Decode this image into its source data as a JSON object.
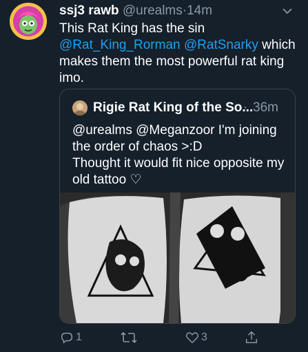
{
  "tweet": {
    "display_name": "ssj3 rawb",
    "handle": "@urealms",
    "dot": "·",
    "time": "14m",
    "text_line1": "This Rat King has the sin",
    "mention1": "@Rat_King_Rorman",
    "mention2": "@RatSnarky",
    "text_after": " which makes them the most powerful rat king imo."
  },
  "quote": {
    "display_name": "Rigie Rat King of the So...",
    "dot": "·",
    "time": "36m",
    "line1": "@urealms @Meganzoor I'm joining the order of chaos >:D",
    "line2": "Thought it would fit nice opposite my old tattoo ♡"
  },
  "actions": {
    "reply_count": "1",
    "retweet_count": "",
    "like_count": "3"
  },
  "icons": {
    "chevron": "chevron-down-icon",
    "reply": "reply-icon",
    "retweet": "retweet-icon",
    "like": "heart-icon",
    "share": "share-icon"
  },
  "colors": {
    "background": "#15202b",
    "muted": "#8899a6",
    "link": "#1da1f2",
    "border": "#38444d"
  }
}
